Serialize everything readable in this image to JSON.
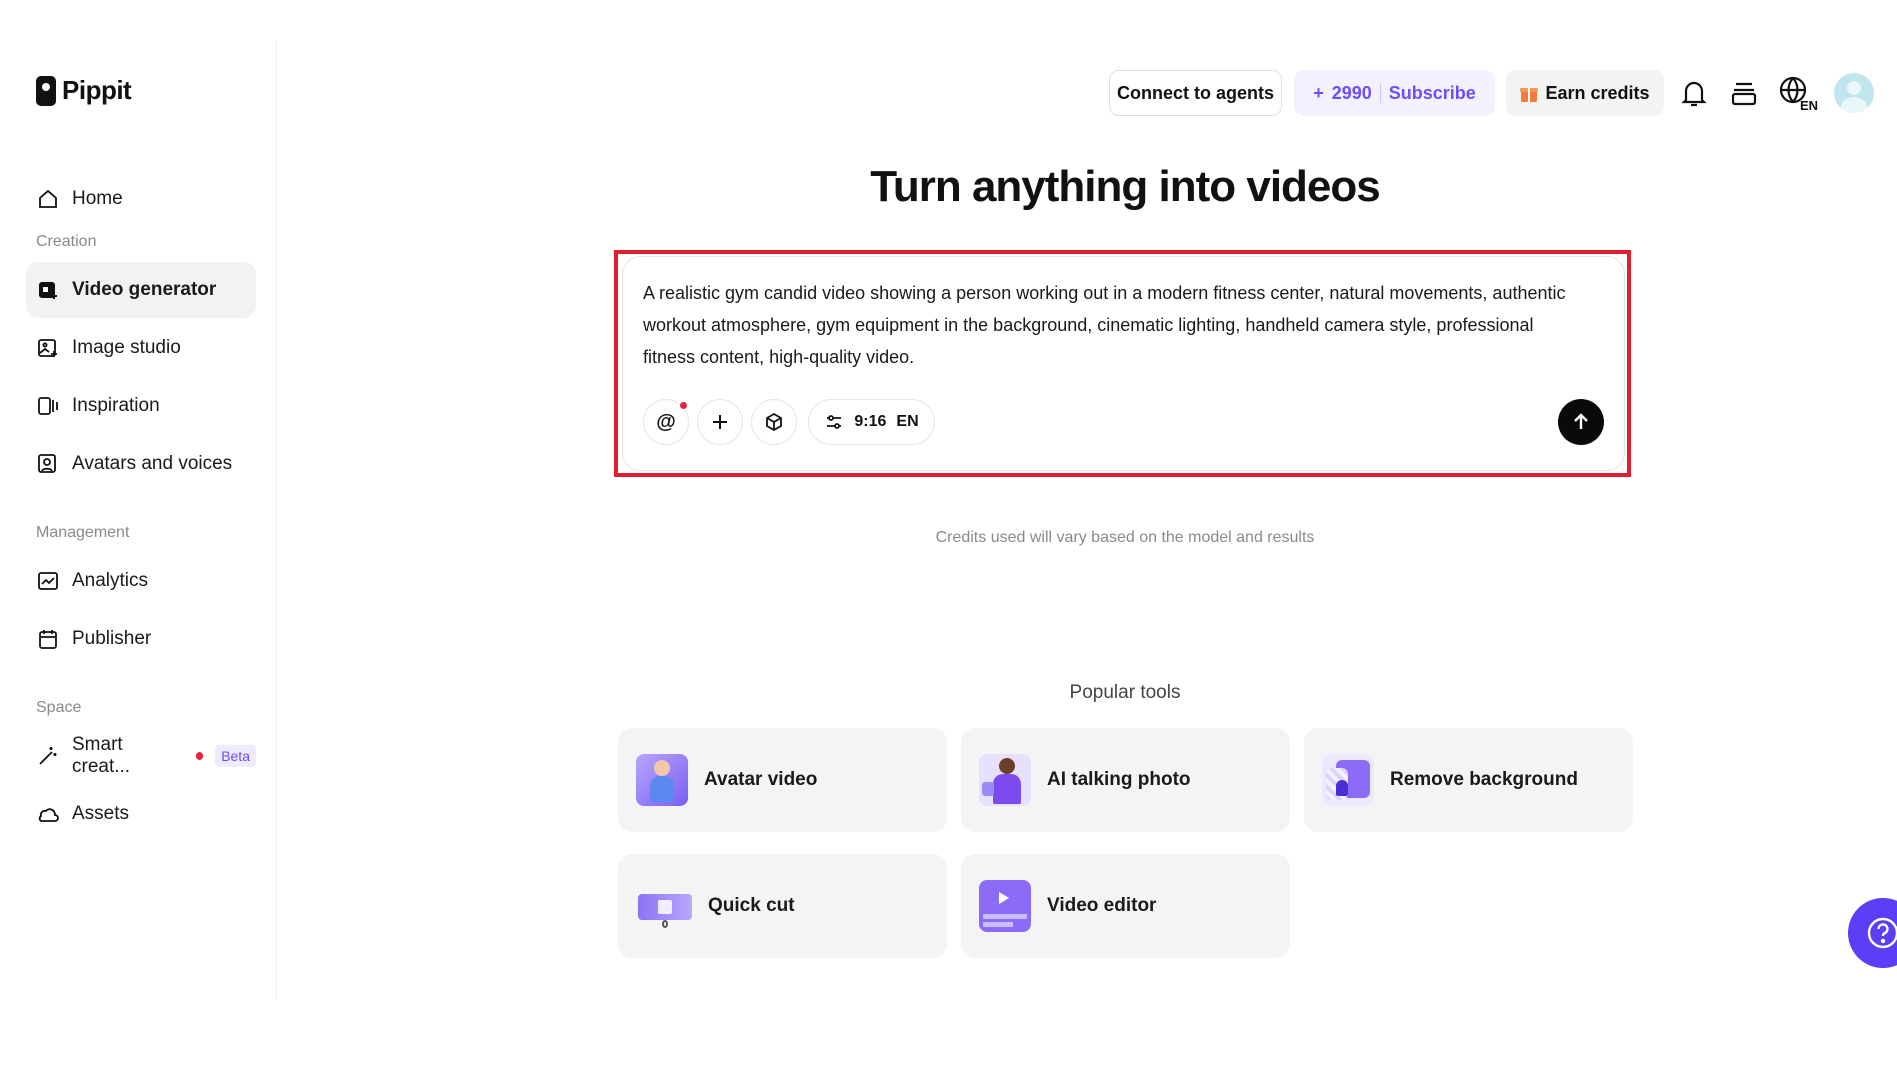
{
  "brand": {
    "name": "Pippit"
  },
  "sidebar": {
    "home": "Home",
    "sections": [
      {
        "label": "Creation",
        "items": [
          "Video generator",
          "Image studio",
          "Inspiration",
          "Avatars and voices"
        ]
      },
      {
        "label": "Management",
        "items": [
          "Analytics",
          "Publisher"
        ]
      },
      {
        "label": "Space",
        "items": [
          "Smart creat...",
          "Assets"
        ]
      }
    ],
    "beta_badge": "Beta",
    "active_item": "Video generator"
  },
  "header": {
    "connect_label": "Connect to agents",
    "credits_value": "2990",
    "subscribe_label": "Subscribe",
    "earn_label": "Earn credits",
    "language_badge": "EN"
  },
  "main": {
    "title": "Turn anything into videos",
    "prompt_text": "A realistic gym candid video showing a person working out in a modern fitness center, natural movements, authentic workout atmosphere, gym equipment in the background, cinematic lighting, handheld camera style, professional fitness content, high-quality video.",
    "settings": {
      "ratio": "9:16",
      "language": "EN"
    },
    "credits_note": "Credits used will vary based on the model and results",
    "popular_title": "Popular tools",
    "tools": [
      "Avatar video",
      "AI talking photo",
      "Remove background",
      "Quick cut",
      "Video editor"
    ]
  },
  "colors": {
    "accent": "#6f4dfc",
    "highlight": "#e01e2f",
    "help": "#5b3ef5"
  }
}
